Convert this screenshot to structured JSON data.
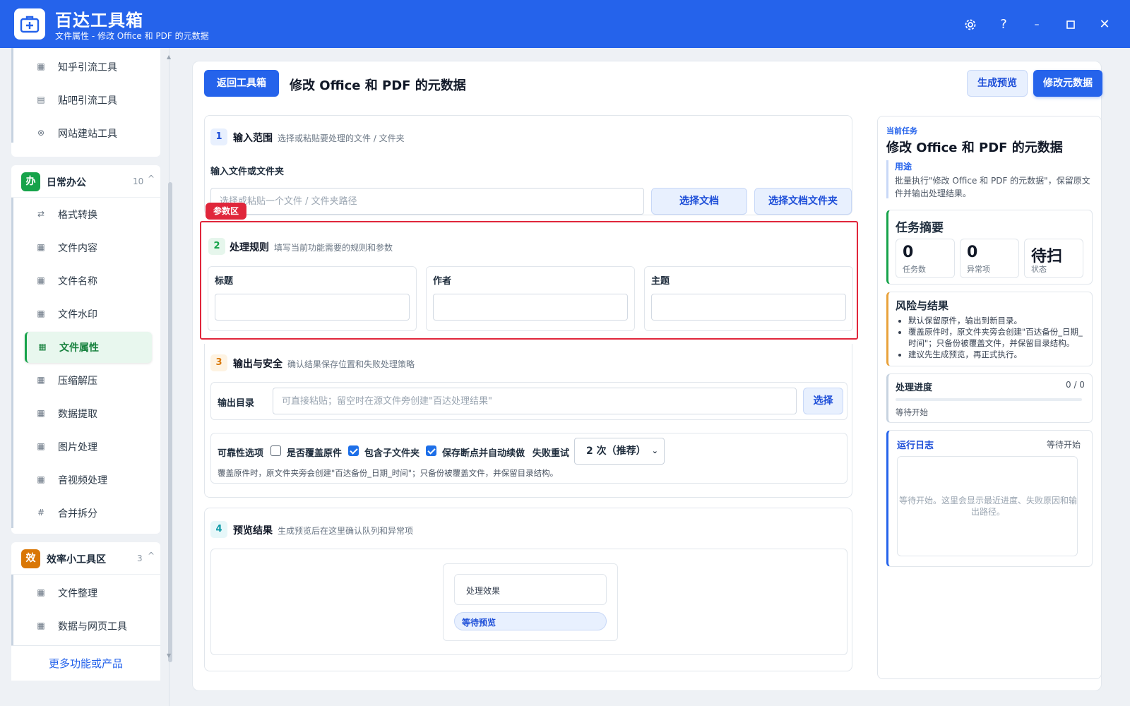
{
  "app": {
    "name": "百达工具箱",
    "subtitle": "文件属性 - 修改 Office 和 PDF 的元数据",
    "controls": [
      "settings-icon",
      "help-icon",
      "minimize-icon",
      "maximize-icon",
      "close-icon"
    ]
  },
  "sidebar": {
    "top_items": [
      {
        "label": "知乎引流工具",
        "icon": "zhihu-icon"
      },
      {
        "label": "贴吧引流工具",
        "icon": "tieba-icon"
      },
      {
        "label": "网站建站工具",
        "icon": "globe-icon"
      }
    ],
    "groups": [
      {
        "badge": "办",
        "title": "日常办公",
        "count": "10",
        "caret": "^",
        "color": "#16a34a",
        "items": [
          {
            "label": "格式转换",
            "icon": "swap-icon"
          },
          {
            "label": "文件内容",
            "icon": "grid-icon"
          },
          {
            "label": "文件名称",
            "icon": "grid-icon"
          },
          {
            "label": "文件水印",
            "icon": "grid-icon"
          },
          {
            "label": "文件属性",
            "icon": "grid-icon",
            "active": true
          },
          {
            "label": "压缩解压",
            "icon": "grid-icon"
          },
          {
            "label": "数据提取",
            "icon": "grid-icon"
          },
          {
            "label": "图片处理",
            "icon": "grid-icon"
          },
          {
            "label": "音视频处理",
            "icon": "grid-icon"
          },
          {
            "label": "合并拆分",
            "icon": "hash-icon"
          }
        ]
      },
      {
        "badge": "效",
        "title": "效率小工具区",
        "count": "3",
        "caret": "^",
        "color": "#d97706",
        "items": [
          {
            "label": "文件整理",
            "icon": "grid-icon"
          },
          {
            "label": "数据与网页工具",
            "icon": "grid-icon"
          }
        ]
      }
    ],
    "more_link": "更多功能或产品"
  },
  "main": {
    "back_button": "返回工具箱",
    "title": "修改 Office 和 PDF 的元数据",
    "preview_button": "生成预览",
    "run_button": "修改元数据",
    "sections": {
      "input": {
        "num": "1",
        "title": "输入范围",
        "desc": "选择或粘贴要处理的文件 / 文件夹",
        "field_label": "输入文件或文件夹",
        "placeholder": "选择或粘贴一个文件 / 文件夹路径",
        "btn_file": "选择文档",
        "btn_folder": "选择文档文件夹"
      },
      "rules": {
        "tag": "参数区",
        "num": "2",
        "title": "处理规则",
        "desc": "填写当前功能需要的规则和参数",
        "fields": [
          {
            "label": "标题",
            "value": ""
          },
          {
            "label": "作者",
            "value": ""
          },
          {
            "label": "主题",
            "value": ""
          }
        ]
      },
      "output": {
        "num": "3",
        "title": "输出与安全",
        "desc": "确认结果保存位置和失败处理策略",
        "dir_label": "输出目录",
        "dir_placeholder": "可直接粘贴；留空时在源文件旁创建\"百达处理结果\"",
        "dir_button": "选择",
        "reliability_label": "可靠性选项",
        "options": [
          {
            "label": "是否覆盖原件",
            "checked": false
          },
          {
            "label": "包含子文件夹",
            "checked": true
          },
          {
            "label": "保存断点并自动续做",
            "checked": true
          }
        ],
        "retry_label": "失败重试",
        "retry_value": "2 次（推荐）",
        "note": "覆盖原件时，原文件夹旁会创建\"百达备份_日期_时间\"；只备份被覆盖文件，并保留目录结构。"
      },
      "preview": {
        "num": "4",
        "title": "预览结果",
        "desc": "生成预览后在这里确认队列和异常项",
        "effect_label": "处理效果",
        "status": "等待预览"
      }
    }
  },
  "panel": {
    "kicker": "当前任务",
    "title": "修改 Office 和 PDF 的元数据",
    "usage_label": "用途",
    "usage_text": "批量执行\"修改 Office 和 PDF 的元数据\"，保留原文件并输出处理结果。",
    "summary": {
      "title": "任务摘要",
      "stats": [
        {
          "value": "0",
          "key": "任务数"
        },
        {
          "value": "0",
          "key": "异常项"
        },
        {
          "value": "待扫",
          "key": "状态"
        }
      ]
    },
    "risk": {
      "title": "风险与结果",
      "items": [
        "默认保留原件，输出到新目录。",
        "覆盖原件时，原文件夹旁会创建\"百达备份_日期_时间\"；只备份被覆盖文件，并保留目录结构。",
        "建议先生成预览，再正式执行。"
      ]
    },
    "progress": {
      "title": "处理进度",
      "count": "0 / 0",
      "fraction": 0,
      "status": "等待开始"
    },
    "log": {
      "title": "运行日志",
      "status": "等待开始",
      "placeholder": "等待开始。这里会显示最近进度、失败原因和输出路径。"
    }
  },
  "colors": {
    "brand": "#2563eb",
    "active_green": "#16a34a",
    "alert_red": "#e0263b"
  }
}
